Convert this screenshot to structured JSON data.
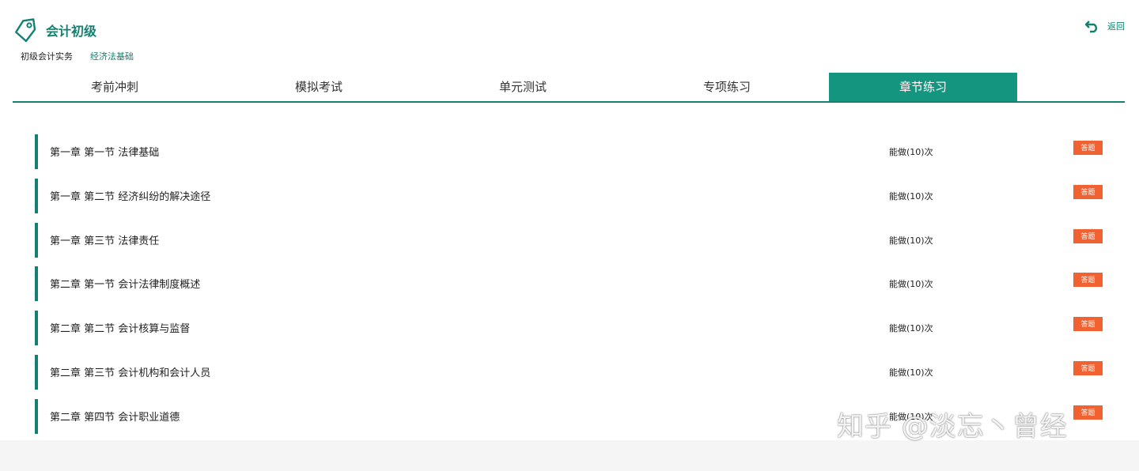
{
  "header": {
    "title": "会计初级",
    "back_label": "返回"
  },
  "subjects": [
    {
      "label": "初级会计实务"
    },
    {
      "label": "经济法基础"
    }
  ],
  "tabs": [
    {
      "label": "考前冲刺"
    },
    {
      "label": "模拟考试"
    },
    {
      "label": "单元测试"
    },
    {
      "label": "专项练习"
    },
    {
      "label": "章节练习"
    }
  ],
  "active_tab": "章节练习",
  "chapters": [
    {
      "title": "第一章 第一节 法律基础",
      "count": "能做(10)次",
      "button": "答题"
    },
    {
      "title": "第一章 第二节 经济纠纷的解决途径",
      "count": "能做(10)次",
      "button": "答题"
    },
    {
      "title": "第一章 第三节 法律责任",
      "count": "能做(10)次",
      "button": "答题"
    },
    {
      "title": "第二章 第一节 会计法律制度概述",
      "count": "能做(10)次",
      "button": "答题"
    },
    {
      "title": "第二章 第二节 会计核算与监督",
      "count": "能做(10)次",
      "button": "答题"
    },
    {
      "title": "第二章 第三节 会计机构和会计人员",
      "count": "能做(10)次",
      "button": "答题"
    },
    {
      "title": "第二章 第四节 会计职业道德",
      "count": "能做(10)次",
      "button": "答题"
    }
  ],
  "watermark": "知乎 @淡忘丶曾经",
  "colors": {
    "accent": "#14806f",
    "tab_active": "#14957f",
    "button": "#f06232"
  },
  "icons": {
    "logo": "tag-icon",
    "back": "undo-arrow-icon"
  }
}
